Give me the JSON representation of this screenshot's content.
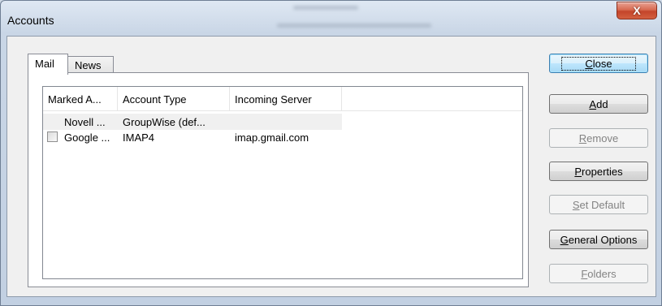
{
  "window": {
    "title": "Accounts",
    "close_glyph": "X"
  },
  "tabs": [
    {
      "label": "Mail",
      "active": true
    },
    {
      "label": "News",
      "active": false
    }
  ],
  "list": {
    "columns": [
      "Marked A...",
      "Account Type",
      "Incoming Server"
    ],
    "rows": [
      {
        "name": "Novell ...",
        "type": "GroupWise (def...",
        "server": "",
        "has_checkbox": false,
        "checked": false
      },
      {
        "name": "Google ...",
        "type": "IMAP4",
        "server": "imap.gmail.com",
        "has_checkbox": true,
        "checked": false
      }
    ]
  },
  "buttons": {
    "close": {
      "label": "Close",
      "mnemonic": "C",
      "enabled": true,
      "default": true
    },
    "add": {
      "label": "Add",
      "mnemonic": "A",
      "enabled": true
    },
    "remove": {
      "label": "Remove",
      "mnemonic": "R",
      "enabled": false
    },
    "properties": {
      "label": "Properties",
      "mnemonic": "P",
      "enabled": true
    },
    "set_default": {
      "label": "Set Default",
      "mnemonic": "S",
      "enabled": false
    },
    "general_options": {
      "label": "General Options",
      "mnemonic": "G",
      "enabled": true
    },
    "folders": {
      "label": "Folders",
      "mnemonic": "F",
      "enabled": false
    }
  }
}
